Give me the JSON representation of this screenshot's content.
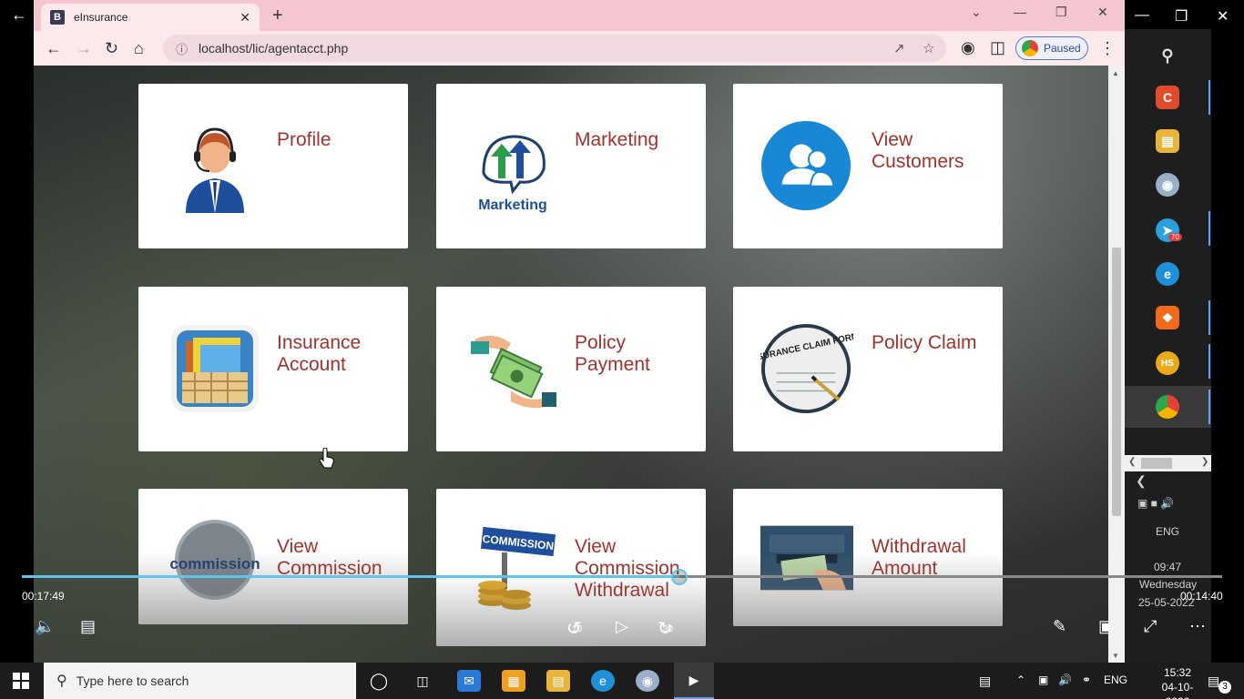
{
  "browser": {
    "tab_title": "eInsurance",
    "tab_favicon": "B",
    "url": "localhost/lic/agentacct.php",
    "profile_status": "Paused"
  },
  "cards": [
    {
      "title": "Profile",
      "icon": "agent-headset-icon"
    },
    {
      "title": "Marketing",
      "icon": "marketing-logo-icon",
      "icon_text": "Marketing"
    },
    {
      "title": "View Customers",
      "icon": "users-icon"
    },
    {
      "title": "Insurance Account",
      "icon": "folders-icon"
    },
    {
      "title": "Policy Payment",
      "icon": "money-hands-icon"
    },
    {
      "title": "Policy Claim",
      "icon": "claim-form-icon",
      "icon_text": "INSURANCE CLAIM FORM"
    },
    {
      "title": "View Commission",
      "icon": "commission-word-icon",
      "icon_text": "commission"
    },
    {
      "title": "View Commission Withdrawal",
      "icon": "commission-coins-icon",
      "icon_text": "COMMISSION"
    },
    {
      "title": "Withdrawal Amount",
      "icon": "atm-cash-icon"
    }
  ],
  "player": {
    "elapsed": "00:17:49",
    "remaining": "00:14:40",
    "progress_fraction": 0.548,
    "skip_back": "10",
    "skip_forward": "30"
  },
  "side_panel": {
    "language": "ENG",
    "time": "09:47",
    "day": "Wednesday",
    "date": "25-05-2022",
    "telegram_badge": "70"
  },
  "taskbar": {
    "search_placeholder": "Type here to search",
    "language": "ENG",
    "time": "15:32",
    "date": "04-10-2022",
    "notification_count": "3"
  }
}
